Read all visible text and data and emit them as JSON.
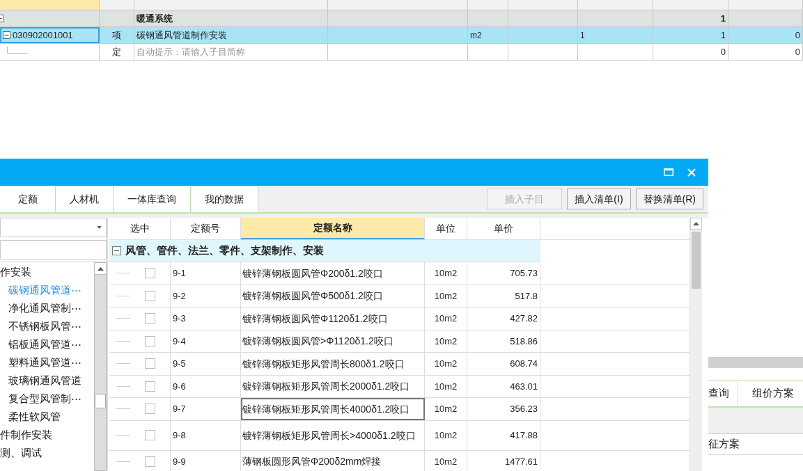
{
  "bill_table": {
    "columns": [
      {
        "sorted": true
      },
      {
        "sorted": false
      },
      {
        "sorted": false
      },
      {
        "sorted": false
      },
      {
        "sorted": false
      },
      {
        "sorted": false
      },
      {
        "sorted": false
      },
      {
        "sorted": false
      },
      {
        "sorted": false
      }
    ],
    "rows": [
      {
        "kind": "group",
        "selected": false,
        "name": "暖通系统",
        "quantity": "1"
      },
      {
        "kind": "item",
        "selected": true,
        "code": "030902001001",
        "category": "项",
        "name": "碳钢通风管道制作安装",
        "unit": "m2",
        "expression": "1",
        "quantity": "1",
        "unit_price": "0"
      },
      {
        "kind": "sub",
        "selected": false,
        "category": "定",
        "name": "自动提示：请输入子目简称",
        "quantity": "0",
        "unit_price": "0"
      }
    ]
  },
  "back_panel": {
    "tabs": [
      "查询",
      "组价方案"
    ],
    "row_text": "征方案"
  },
  "dialog": {
    "tabs": [
      "定额",
      "人材机",
      "一体库查询",
      "我的数据"
    ],
    "buttons": [
      {
        "label": "插入子目",
        "disabled": true
      },
      {
        "label": "插入清单(I)",
        "disabled": false
      },
      {
        "label": "替换清单(R)",
        "disabled": false
      }
    ],
    "tree": [
      {
        "label": "作安装",
        "selected": false,
        "children": [
          {
            "label": "碳钢通风管道⋯",
            "selected": true
          },
          {
            "label": "净化通风管制⋯",
            "selected": false
          },
          {
            "label": "不锈钢板风管⋯",
            "selected": false
          },
          {
            "label": "铝板通风管道⋯",
            "selected": false
          },
          {
            "label": "塑料通风管道⋯",
            "selected": false
          },
          {
            "label": "玻璃钢通风管道",
            "selected": false
          },
          {
            "label": "复合型风管制⋯",
            "selected": false
          },
          {
            "label": "柔性软风管",
            "selected": false
          }
        ]
      },
      {
        "label": "件制作安装",
        "selected": false
      },
      {
        "label": "测、调试",
        "selected": false
      }
    ],
    "grid": {
      "columns": [
        {
          "label": "选中",
          "sorted": false
        },
        {
          "label": "定额号",
          "sorted": false
        },
        {
          "label": "定额名称",
          "sorted": true
        },
        {
          "label": "单位",
          "sorted": false
        },
        {
          "label": "单价",
          "sorted": false
        }
      ],
      "group": {
        "label": "风管、管件、法兰、零件、支架制作、安装",
        "expanded": true
      },
      "rows": [
        {
          "checked": false,
          "focused": false,
          "code": "9-1",
          "name": "镀锌薄钢板圆风管Φ200δ1.2咬口",
          "unit": "10m2",
          "price": "705.73"
        },
        {
          "checked": false,
          "focused": false,
          "code": "9-2",
          "name": "镀锌薄钢板圆风管Φ500δ1.2咬口",
          "unit": "10m2",
          "price": "517.8"
        },
        {
          "checked": false,
          "focused": false,
          "code": "9-3",
          "name": "镀锌薄钢板圆风管Φ1120δ1.2咬口",
          "unit": "10m2",
          "price": "427.82"
        },
        {
          "checked": false,
          "focused": false,
          "code": "9-4",
          "name": "镀锌薄钢板圆风管>Φ1120δ1.2咬口",
          "unit": "10m2",
          "price": "518.86"
        },
        {
          "checked": false,
          "focused": false,
          "code": "9-5",
          "name": "镀锌薄钢板矩形风管周长800δ1.2咬口",
          "unit": "10m2",
          "price": "608.74"
        },
        {
          "checked": false,
          "focused": false,
          "code": "9-6",
          "name": "镀锌薄钢板矩形风管周长2000δ1.2咬口",
          "unit": "10m2",
          "price": "463.01"
        },
        {
          "checked": false,
          "focused": true,
          "code": "9-7",
          "name": "镀锌薄钢板矩形风管周长4000δ1.2咬口",
          "unit": "10m2",
          "price": "356.23"
        },
        {
          "checked": false,
          "focused": false,
          "code": "9-8",
          "name": "镀锌薄钢板矩形风管周长>4000δ1.2咬口",
          "unit": "10m2",
          "price": "417.88"
        },
        {
          "checked": false,
          "focused": false,
          "code": "9-9",
          "name": "薄钢板圆形风管Φ200δ2mm焊接",
          "unit": "10m2",
          "price": "1477.61"
        }
      ]
    }
  }
}
